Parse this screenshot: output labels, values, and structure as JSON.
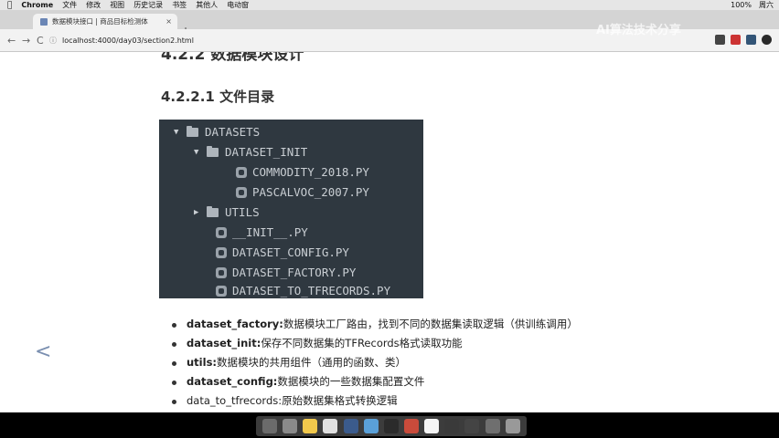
{
  "menubar": {
    "app": "Chrome",
    "items": [
      "文件",
      "修改",
      "视图",
      "历史记录",
      "书签",
      "其他人",
      "电动窗"
    ],
    "status": [
      "100%",
      "周六"
    ]
  },
  "tab": {
    "title": "数据模块接口 | 商品目标检测体",
    "close": "×",
    "new": "+"
  },
  "toolbar": {
    "back": "←",
    "forward": "→",
    "reload": "C",
    "url": "localhost:4000/day03/section2.html"
  },
  "watermark": "AI算法技术分享",
  "page": {
    "heading2": "4.2.2 数据模块设计",
    "heading3": "4.2.2.1 文件目录",
    "tree": [
      {
        "label": "DATASETS",
        "kind": "folder",
        "arrow": "▼",
        "depth": 0
      },
      {
        "label": "DATASET_INIT",
        "kind": "folder",
        "arrow": "▼",
        "depth": 1
      },
      {
        "label": "COMMODITY_2018.PY",
        "kind": "file",
        "arrow": "",
        "depth": 3
      },
      {
        "label": "PASCALVOC_2007.PY",
        "kind": "file",
        "arrow": "",
        "depth": 3
      },
      {
        "label": "UTILS",
        "kind": "folder",
        "arrow": "▶",
        "depth": 1
      },
      {
        "label": "__INIT__.PY",
        "kind": "file",
        "arrow": "",
        "depth": 2
      },
      {
        "label": "DATASET_CONFIG.PY",
        "kind": "file",
        "arrow": "",
        "depth": 2
      },
      {
        "label": "DATASET_FACTORY.PY",
        "kind": "file",
        "arrow": "",
        "depth": 2
      },
      {
        "label": "DATASET_TO_TFRECORDS.PY",
        "kind": "file",
        "arrow": "",
        "depth": 2
      }
    ],
    "bullets": [
      {
        "key": "dataset_factory:",
        "text": "数据模块工厂路由，找到不同的数据集读取逻辑（供训练调用）"
      },
      {
        "key": "dataset_init:",
        "text": "保存不同数据集的TFRecords格式读取功能"
      },
      {
        "key": "utils:",
        "text": "数据模块的共用组件（通用的函数、类）"
      },
      {
        "key": "dataset_config:",
        "text": "数据模块的一些数据集配置文件"
      },
      {
        "key": "data_to_tfrecords:",
        "text": "原始数据集格式转换逻辑"
      }
    ],
    "prev_arrow": "<"
  },
  "dock": {
    "colors": [
      "#6b6b6b",
      "#8a8a8a",
      "#f2c94c",
      "#e0e0e0",
      "#3b5b8c",
      "#5aa0d8",
      "#2b2b2b",
      "#c94b3b",
      "#f5f5f5",
      "#3a3a3a",
      "#444",
      "#6f6f6f",
      "#999"
    ]
  }
}
